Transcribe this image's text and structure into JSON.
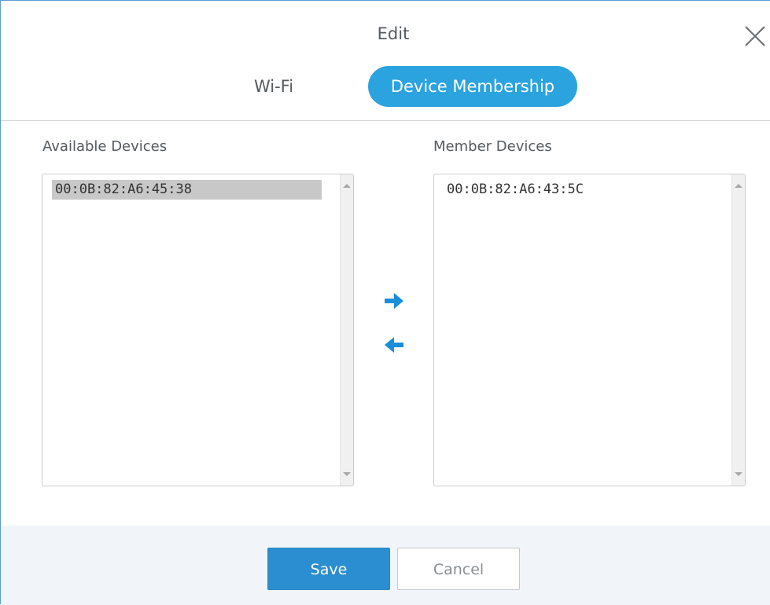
{
  "dialog": {
    "title": "Edit",
    "close_icon": "close-icon"
  },
  "tabs": [
    {
      "label": "Wi-Fi",
      "active": false
    },
    {
      "label": "Device Membership",
      "active": true
    }
  ],
  "available": {
    "label": "Available Devices",
    "items": [
      "00:0B:82:A6:45:38"
    ],
    "selected_index": 0
  },
  "member": {
    "label": "Member Devices",
    "items": [
      "00:0B:82:A6:43:5C"
    ]
  },
  "transfer": {
    "add_icon": "arrow-right-icon",
    "remove_icon": "arrow-left-icon"
  },
  "footer": {
    "save_label": "Save",
    "cancel_label": "Cancel"
  },
  "colors": {
    "accent": "#2ba3df",
    "save_button": "#2b8ed0",
    "selection": "#c8c8c8",
    "footer_bg": "#f1f5f9",
    "arrow": "#1a8fd8"
  }
}
